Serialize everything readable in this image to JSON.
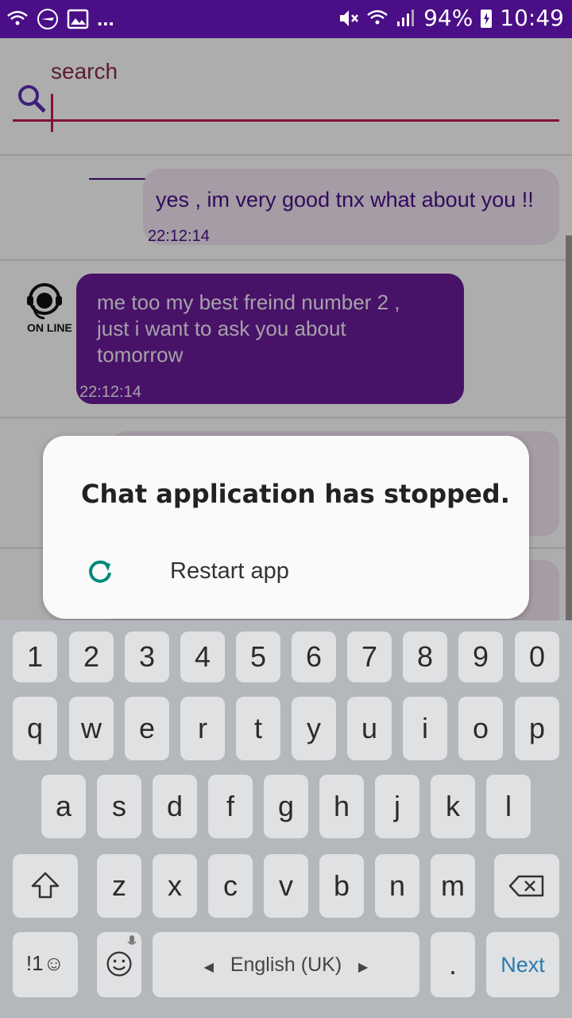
{
  "status_bar": {
    "battery": "94%",
    "time": "10:49",
    "overflow": "..."
  },
  "search": {
    "hint": "search"
  },
  "messages": [
    {
      "text": "yes , im very good tnx what about you !!",
      "time": "22:12:14",
      "side": "right"
    },
    {
      "text": "me too my best freind number 2 , just i want to ask you about tomorrow",
      "time": "22:12:14",
      "side": "left",
      "avatar_label": "ON LINE"
    }
  ],
  "dialog": {
    "title": "Chat application has stopped.",
    "restart_label": "Restart app"
  },
  "keyboard": {
    "row_numbers": [
      "1",
      "2",
      "3",
      "4",
      "5",
      "6",
      "7",
      "8",
      "9",
      "0"
    ],
    "row_top": [
      "q",
      "w",
      "e",
      "r",
      "t",
      "y",
      "u",
      "i",
      "o",
      "p"
    ],
    "row_middle": [
      "a",
      "s",
      "d",
      "f",
      "g",
      "h",
      "j",
      "k",
      "l"
    ],
    "row_bottom": [
      "z",
      "x",
      "c",
      "v",
      "b",
      "n",
      "m"
    ],
    "symbols_label": "!1☺",
    "language_label": "English (UK)",
    "period_label": ".",
    "action_label": "Next"
  },
  "colors": {
    "status_bar": "#4a0f86",
    "accent": "#c2185b",
    "bubble_left": "#6a1b9a",
    "bubble_right": "#f3e6f4",
    "restart_icon": "#00897b"
  }
}
